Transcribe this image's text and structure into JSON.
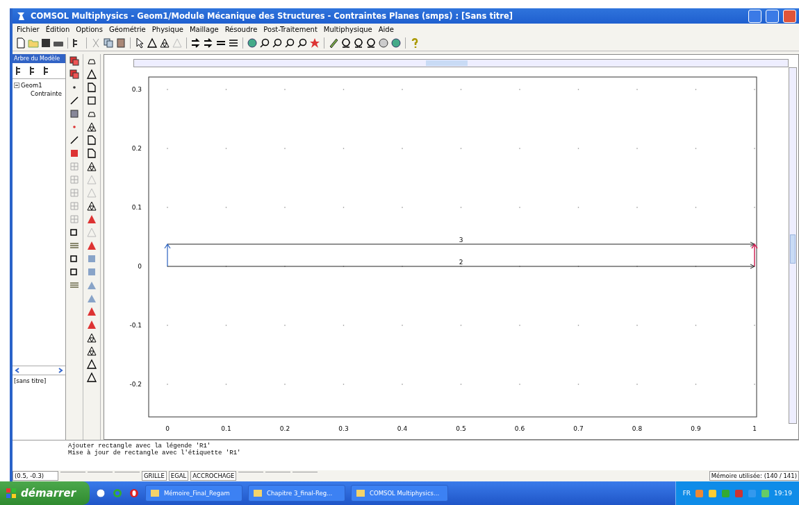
{
  "window": {
    "title": "COMSOL Multiphysics - Geom1/Module Mécanique des Structures - Contraintes Planes (smps) : [Sans titre]"
  },
  "menu": [
    "Fichier",
    "Édition",
    "Options",
    "Géométrie",
    "Physique",
    "Maillage",
    "Résoudre",
    "Post-Traitement",
    "Multiphysique",
    "Aide"
  ],
  "model_tree": {
    "header": "Arbre du Modèle",
    "items": [
      {
        "label": "Geom1",
        "expanded": true,
        "children": [
          {
            "label": "Contrainte"
          }
        ]
      }
    ],
    "file": "[sans titre]"
  },
  "plot": {
    "xticks": [
      "0",
      "0.1",
      "0.2",
      "0.3",
      "0.4",
      "0.5",
      "0.6",
      "0.7",
      "0.8",
      "0.9",
      "1"
    ],
    "yticks": [
      "0.3",
      "0.2",
      "0.1",
      "0",
      "-0.1",
      "-0.2"
    ],
    "edges": [
      {
        "label": "3",
        "kind": "top"
      },
      {
        "label": "2",
        "kind": "bottom"
      }
    ]
  },
  "log": [
    "Ajouter rectangle avec la légende 'R1'",
    "Mise à jour de rectangle avec l'étiquette 'R1'"
  ],
  "status_bar": {
    "coordinates": "(0.5, -0.3)",
    "toggles": [
      "GRILLE",
      "EGAL",
      "ACCROCHAGE"
    ],
    "memory": "Mémoire utilisée: (140 / 141)"
  },
  "taskbar": {
    "start": "démarrer",
    "tasks": [
      "Mémoire_Final_Regam",
      "Chapitre 3_final-Reg...",
      "COMSOL Multiphysics..."
    ],
    "language": "FR",
    "clock": "19:19"
  }
}
